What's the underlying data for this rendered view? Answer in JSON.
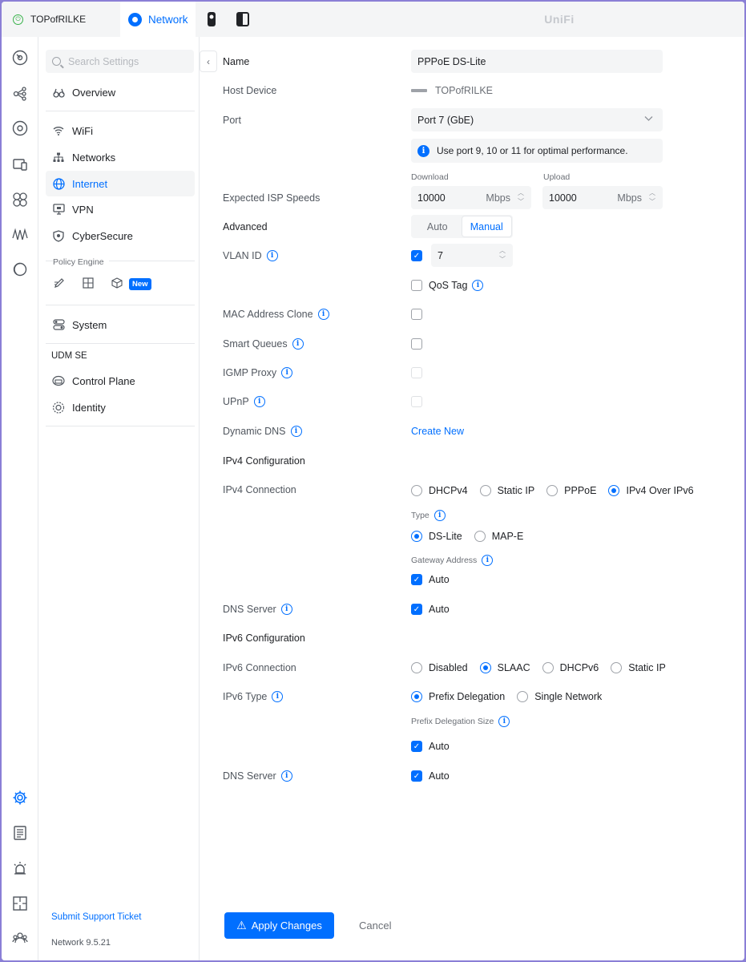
{
  "topbar": {
    "host_tab": "TOPofRILKE",
    "network_tab": "Network",
    "brand": "UniFi"
  },
  "nav": {
    "search_placeholder": "Search Settings",
    "items": [
      {
        "label": "Overview",
        "icon": "binoculars-icon"
      },
      {
        "label": "WiFi",
        "icon": "wifi-icon"
      },
      {
        "label": "Networks",
        "icon": "network-tree-icon"
      },
      {
        "label": "Internet",
        "icon": "globe-icon"
      },
      {
        "label": "VPN",
        "icon": "vpn-icon"
      },
      {
        "label": "CyberSecure",
        "icon": "shield-icon"
      },
      {
        "label": "System",
        "icon": "toggles-icon"
      },
      {
        "label": "Control Plane",
        "icon": "control-plane-icon"
      },
      {
        "label": "Identity",
        "icon": "identity-icon"
      }
    ],
    "policy_engine_caption": "Policy Engine",
    "new_badge": "New",
    "udm_caption": "UDM SE",
    "support_link": "Submit Support Ticket",
    "version": "Network 9.5.21"
  },
  "form": {
    "name_label": "Name",
    "name_value": "PPPoE DS-Lite",
    "host_label": "Host Device",
    "host_value": "TOPofRILKE",
    "port_label": "Port",
    "port_value": "Port 7 (GbE)",
    "port_notice": "Use port 9, 10 or 11 for optimal performance.",
    "isp_label": "Expected ISP Speeds",
    "download_caption": "Download",
    "upload_caption": "Upload",
    "download_value": "10000",
    "upload_value": "10000",
    "speed_unit": "Mbps",
    "advanced_label": "Advanced",
    "advanced_options": [
      "Auto",
      "Manual"
    ],
    "advanced_selected": "Manual",
    "vlan_label": "VLAN ID",
    "vlan_value": "7",
    "qos_label": "QoS Tag",
    "mac_clone_label": "MAC Address Clone",
    "smart_queues_label": "Smart Queues",
    "igmp_label": "IGMP Proxy",
    "upnp_label": "UPnP",
    "ddns_label": "Dynamic DNS",
    "ddns_link": "Create New",
    "ipv4_heading": "IPv4 Configuration",
    "ipv4_conn_label": "IPv4 Connection",
    "ipv4_options": [
      "DHCPv4",
      "Static IP",
      "PPPoE",
      "IPv4 Over IPv6"
    ],
    "ipv4_selected": "IPv4 Over IPv6",
    "type_caption": "Type",
    "type_options": [
      "DS-Lite",
      "MAP-E"
    ],
    "type_selected": "DS-Lite",
    "gateway_caption": "Gateway Address",
    "auto_label": "Auto",
    "dns4_label": "DNS Server",
    "ipv6_heading": "IPv6 Configuration",
    "ipv6_conn_label": "IPv6 Connection",
    "ipv6_options": [
      "Disabled",
      "SLAAC",
      "DHCPv6",
      "Static IP"
    ],
    "ipv6_selected": "SLAAC",
    "ipv6_type_label": "IPv6 Type",
    "ipv6_type_options": [
      "Prefix Delegation",
      "Single Network"
    ],
    "ipv6_type_selected": "Prefix Delegation",
    "pd_size_caption": "Prefix Delegation Size",
    "dns6_label": "DNS Server",
    "apply_button": "Apply Changes",
    "cancel_button": "Cancel"
  }
}
